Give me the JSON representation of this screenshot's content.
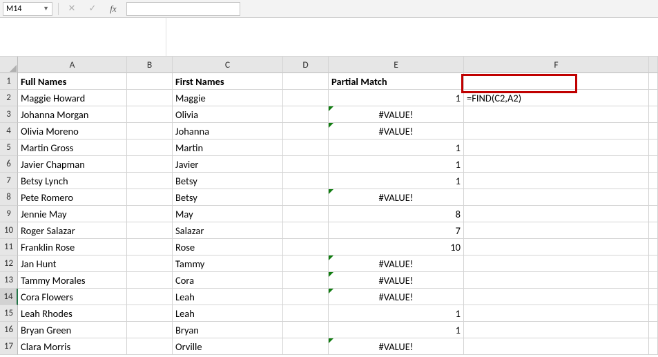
{
  "formula_bar": {
    "name_box": "M14",
    "cancel_glyph": "✕",
    "confirm_glyph": "✓",
    "fx_glyph": "fx",
    "input_value": ""
  },
  "columns": [
    "A",
    "B",
    "C",
    "D",
    "E",
    "F",
    ""
  ],
  "headers": {
    "A": "Full Names",
    "C": "First Names",
    "E": "Partial Match"
  },
  "highlight_formula": "=FIND(C2,A2)",
  "chart_data": {
    "type": "table",
    "columns": [
      "Full Names",
      "First Names",
      "Partial Match"
    ],
    "rows": [
      {
        "full": "Maggie Howard",
        "first": "Maggie",
        "match": "1"
      },
      {
        "full": "Johanna Morgan",
        "first": "Olivia",
        "match": "#VALUE!"
      },
      {
        "full": "Olivia Moreno",
        "first": "Johanna",
        "match": "#VALUE!"
      },
      {
        "full": "Martin Gross",
        "first": "Martin",
        "match": "1"
      },
      {
        "full": "Javier Chapman",
        "first": "Javier",
        "match": "1"
      },
      {
        "full": "Betsy Lynch",
        "first": "Betsy",
        "match": "1"
      },
      {
        "full": "Pete Romero",
        "first": "Betsy",
        "match": "#VALUE!"
      },
      {
        "full": "Jennie May",
        "first": "May",
        "match": "8"
      },
      {
        "full": "Roger Salazar",
        "first": "Salazar",
        "match": "7"
      },
      {
        "full": "Franklin Rose",
        "first": "Rose",
        "match": "10"
      },
      {
        "full": "Jan Hunt",
        "first": "Tammy",
        "match": "#VALUE!"
      },
      {
        "full": "Tammy Morales",
        "first": "Cora",
        "match": "#VALUE!"
      },
      {
        "full": "Cora Flowers",
        "first": "Leah",
        "match": "#VALUE!"
      },
      {
        "full": "Leah Rhodes",
        "first": "Leah",
        "match": "1"
      },
      {
        "full": "Bryan Green",
        "first": "Bryan",
        "match": "1"
      },
      {
        "full": "Clara Morris",
        "first": "Orville",
        "match": "#VALUE!"
      }
    ]
  },
  "selected_row": 14
}
